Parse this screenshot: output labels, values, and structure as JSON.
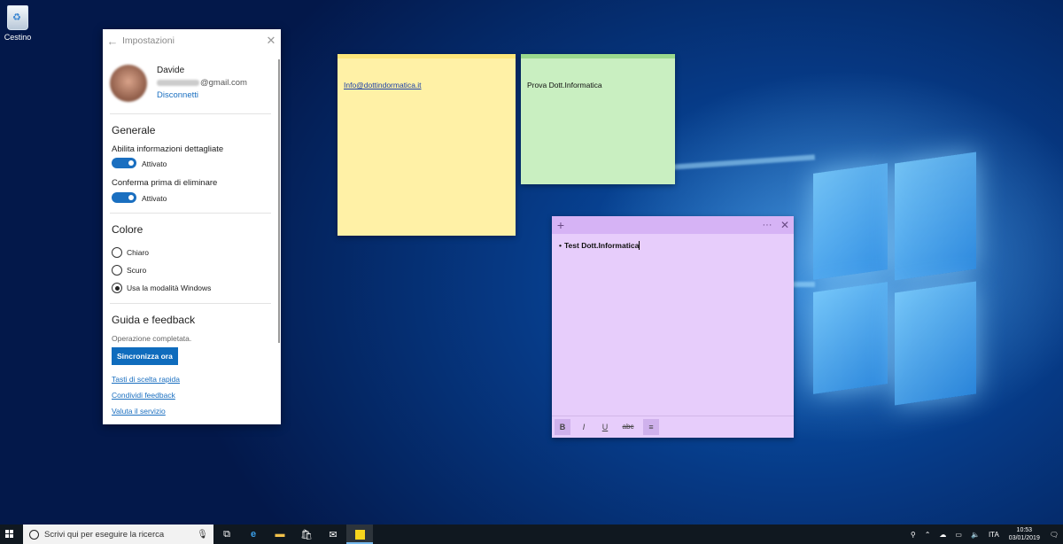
{
  "desktop": {
    "recycle_bin_label": "Cestino"
  },
  "settings": {
    "title": "Impostazioni",
    "account": {
      "name": "Davide",
      "email_visible": "@gmail.com",
      "disconnect": "Disconnetti"
    },
    "general": {
      "heading": "Generale",
      "detail_label": "Abilita informazioni dettagliate",
      "detail_state": "Attivato",
      "confirm_label": "Conferma prima di eliminare",
      "confirm_state": "Attivato"
    },
    "color": {
      "heading": "Colore",
      "options": [
        "Chiaro",
        "Scuro",
        "Usa la modalità Windows"
      ],
      "selected": "Usa la modalità Windows"
    },
    "help": {
      "heading": "Guida e feedback",
      "status": "Operazione completata.",
      "sync_button": "Sincronizza ora",
      "links": [
        "Tasti di scelta rapida",
        "Condividi feedback",
        "Valuta il servizio"
      ]
    }
  },
  "notes": {
    "yellow": {
      "text": "Info@dottindormatica.it",
      "color": "#fff1a6"
    },
    "green": {
      "text": "Prova Dott.Informatica",
      "color": "#c9efc1"
    },
    "purple": {
      "text": "Test Dott.Informatica",
      "color": "#e7cdfb"
    },
    "toolbar": {
      "bold": "B",
      "italic": "I",
      "underline": "U",
      "strike": "abc",
      "list": "≡"
    }
  },
  "taskbar": {
    "search_placeholder": "Scrivi qui per eseguire la ricerca",
    "apps": [
      "task-view-icon",
      "edge-icon",
      "file-explorer-icon",
      "store-icon",
      "mail-icon",
      "sticky-notes-icon"
    ],
    "language": "ITA",
    "time": "10:53",
    "date": "03/01/2019"
  }
}
